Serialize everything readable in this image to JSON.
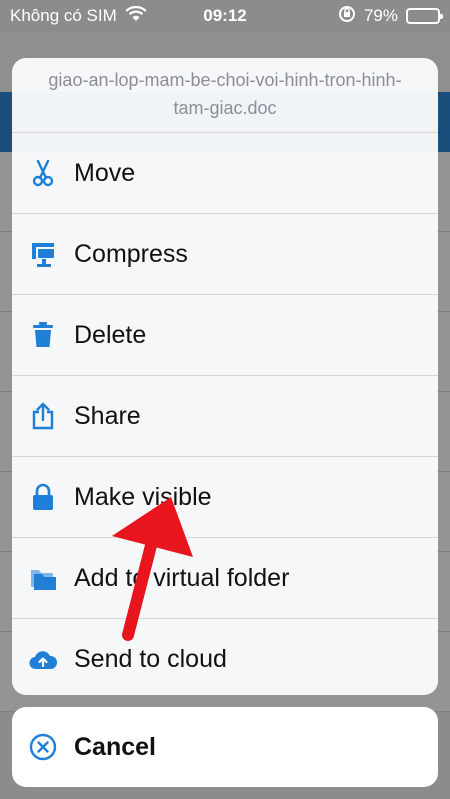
{
  "status_bar": {
    "carrier": "Không có SIM",
    "time": "09:12",
    "battery": "79%",
    "battery_level": 0.79
  },
  "action_sheet": {
    "title": "giao-an-lop-mam-be-choi-voi-hinh-tron-hinh-tam-giac.doc",
    "actions": [
      {
        "label": "Move",
        "icon": "scissors-icon"
      },
      {
        "label": "Compress",
        "icon": "compress-icon"
      },
      {
        "label": "Delete",
        "icon": "trash-icon"
      },
      {
        "label": "Share",
        "icon": "share-icon"
      },
      {
        "label": "Make visible",
        "icon": "lock-icon"
      },
      {
        "label": "Add to virtual folder",
        "icon": "folder-icon"
      },
      {
        "label": "Send to cloud",
        "icon": "cloud-upload-icon"
      }
    ],
    "cancel_label": "Cancel"
  },
  "colors": {
    "accent": "#2a86d6",
    "annotation": "#e8141e",
    "battery": "#4cd964"
  }
}
